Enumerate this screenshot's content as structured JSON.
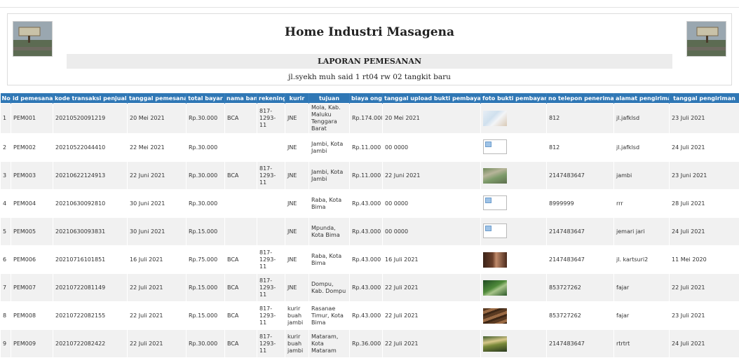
{
  "header": {
    "title": "Home Industri Masagena",
    "subtitle": "LAPORAN PEMESANAN",
    "address": "jl.syekh muh said 1 rt04 rw 02 tangkit baru"
  },
  "table": {
    "columns": [
      "No",
      "id pemesanan",
      "kode transaksi penjualan",
      "tanggal pemesanan",
      "total bayar",
      "nama bank",
      "rekening",
      "kurir",
      "tujuan",
      "biaya ongkir",
      "tanggal upload bukti pembayaran",
      "foto bukti pembayaran",
      "no telepon penerima",
      "alamat pengiriman",
      "tanggal pengiriman"
    ],
    "rows": [
      {
        "no": "1",
        "id": "PEM001",
        "kode": "20210520091219",
        "tgl": "20 Mei 2021",
        "total": "Rp.30.000",
        "bank": "BCA",
        "rek": "817-1293-11",
        "kurir": "JNE",
        "tujuan": "Mola, Kab. Maluku Tenggara Barat",
        "ongkir": "Rp.174.000",
        "upload": "20 Mei 2021",
        "foto": "photo-light",
        "telp": "812",
        "alamat": "jl.jafklsd",
        "kirim": "23 Juli 2021"
      },
      {
        "no": "2",
        "id": "PEM002",
        "kode": "20210522044410",
        "tgl": "22 Mei 2021",
        "total": "Rp.30.000",
        "bank": "",
        "rek": "",
        "kurir": "JNE",
        "tujuan": "Jambi, Kota Jambi",
        "ongkir": "Rp.11.000",
        "upload": "00 0000",
        "foto": "broken",
        "telp": "812",
        "alamat": "jl.jafklsd",
        "kirim": "24 Juli 2021"
      },
      {
        "no": "3",
        "id": "PEM003",
        "kode": "20210622124913",
        "tgl": "22 Juni 2021",
        "total": "Rp.30.000",
        "bank": "BCA",
        "rek": "817-1293-11",
        "kurir": "JNE",
        "tujuan": "Jambi, Kota Jambi",
        "ongkir": "Rp.11.000",
        "upload": "22 Juni 2021",
        "foto": "photo-plants",
        "telp": "2147483647",
        "alamat": "jambi",
        "kirim": "23 Juni 2021"
      },
      {
        "no": "4",
        "id": "PEM004",
        "kode": "20210630092810",
        "tgl": "30 Juni 2021",
        "total": "Rp.30.000",
        "bank": "",
        "rek": "",
        "kurir": "JNE",
        "tujuan": "Raba, Kota Bima",
        "ongkir": "Rp.43.000",
        "upload": "00 0000",
        "foto": "broken",
        "telp": "8999999",
        "alamat": "rrr",
        "kirim": "28 Juli 2021"
      },
      {
        "no": "5",
        "id": "PEM005",
        "kode": "20210630093831",
        "tgl": "30 Juni 2021",
        "total": "Rp.15.000",
        "bank": "",
        "rek": "",
        "kurir": "JNE",
        "tujuan": "Mpunda, Kota Bima",
        "ongkir": "Rp.43.000",
        "upload": "00 0000",
        "foto": "broken",
        "telp": "2147483647",
        "alamat": "jemari jari",
        "kirim": "24 Juli 2021"
      },
      {
        "no": "6",
        "id": "PEM006",
        "kode": "20210716101851",
        "tgl": "16 Juli 2021",
        "total": "Rp.75.000",
        "bank": "BCA",
        "rek": "817-1293-11",
        "kurir": "JNE",
        "tujuan": "Raba, Kota Bima",
        "ongkir": "Rp.43.000",
        "upload": "16 Juli 2021",
        "foto": "photo-dark",
        "telp": "2147483647",
        "alamat": "jl. kartsuri2",
        "kirim": "11 Mei 2020"
      },
      {
        "no": "7",
        "id": "PEM007",
        "kode": "20210722081149",
        "tgl": "22 Juli 2021",
        "total": "Rp.15.000",
        "bank": "BCA",
        "rek": "817-1293-11",
        "kurir": "JNE",
        "tujuan": "Dompu, Kab. Dompu",
        "ongkir": "Rp.43.000",
        "upload": "22 Juli 2021",
        "foto": "photo-green",
        "telp": "853727262",
        "alamat": "fajar",
        "kirim": "22 Juli 2021"
      },
      {
        "no": "8",
        "id": "PEM008",
        "kode": "20210722082155",
        "tgl": "22 Juli 2021",
        "total": "Rp.15.000",
        "bank": "BCA",
        "rek": "817-1293-11",
        "kurir": "kurir buah jambi",
        "tujuan": "Rasanae Timur, Kota Bima",
        "ongkir": "Rp.43.000",
        "upload": "22 Juli 2021",
        "foto": "photo-brown",
        "telp": "853727262",
        "alamat": "fajar",
        "kirim": "23 Juli 2021"
      },
      {
        "no": "9",
        "id": "PEM009",
        "kode": "20210722082422",
        "tgl": "22 Juli 2021",
        "total": "Rp.30.000",
        "bank": "BCA",
        "rek": "817-1293-11",
        "kurir": "kurir buah jambi",
        "tujuan": "Mataram, Kota Mataram",
        "ongkir": "Rp.36.000",
        "upload": "22 Juli 2021",
        "foto": "photo-food",
        "telp": "2147483647",
        "alamat": "rtrtrt",
        "kirim": "24 Juli 2021"
      }
    ]
  },
  "colors": {
    "header_bg": "#2f77b5",
    "row_alt": "#f1f1f1"
  }
}
